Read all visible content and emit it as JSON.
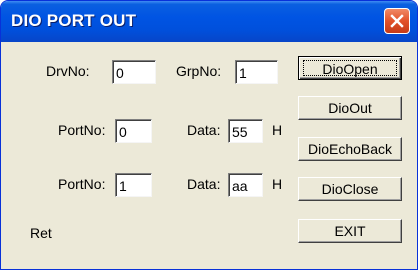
{
  "window": {
    "title": "DIO PORT OUT"
  },
  "form": {
    "drv_label": "DrvNo:",
    "drv_value": "0",
    "grp_label": "GrpNo:",
    "grp_value": "1",
    "port1_label": "PortNo:",
    "port1_value": "0",
    "data1_label": "Data:",
    "data1_value": "55",
    "data1_suffix": "H",
    "port2_label": "PortNo:",
    "port2_value": "1",
    "data2_label": "Data:",
    "data2_value": "aa",
    "data2_suffix": "H",
    "ret_label": "Ret"
  },
  "buttons": {
    "open": "DioOpen",
    "out": "DioOut",
    "echo": "DioEchoBack",
    "close": "DioClose",
    "exit": "EXIT"
  },
  "colors": {
    "titlebar": "#0054e3",
    "face": "#ece9d8",
    "close": "#e2522a"
  }
}
